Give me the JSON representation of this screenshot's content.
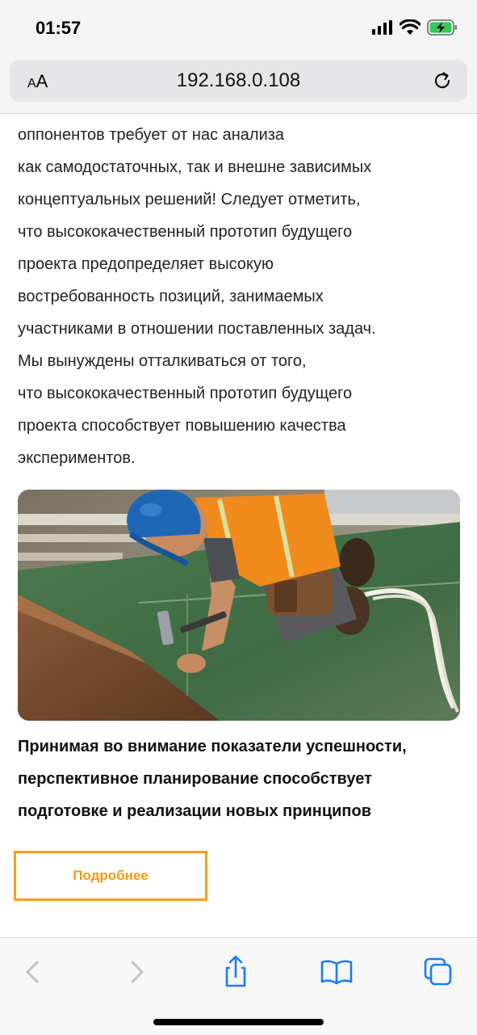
{
  "status_bar": {
    "time": "01:57",
    "icons": [
      "cellular-signal-icon",
      "wifi-icon",
      "battery-charging-icon"
    ]
  },
  "browser": {
    "text_size_label_small": "A",
    "text_size_label_large": "A",
    "url": "192.168.0.108"
  },
  "article": {
    "paragraph_lines": [
      "оппонентов требует от нас анализа",
      "как самодостаточных, так и внешне зависимых",
      "концептуальных решений! Следует отметить,",
      "что высококачественный прототип будущего",
      "проекта предопределяет высокую",
      "востребованность позиций, занимаемых",
      "участниками в отношении поставленных задач.",
      "Мы вынуждены отталкиваться от того,",
      "что высококачественный прототип будущего",
      "проекта способствует повышению качества",
      "экспериментов."
    ],
    "image_subject": "construction worker with blue hard hat hammering nails into roof plywood",
    "caption_lines": [
      "Принимая во внимание показатели успешности,",
      "перспективное планирование способствует",
      "подготовке и реализации новых принципов"
    ],
    "more_button_label": "Подробнее"
  },
  "colors": {
    "accent": "#f5a01a",
    "safari_blue": "#1a7cf5",
    "toolbar_bg": "#f7f7f7"
  },
  "toolbar": {
    "buttons": [
      "back-icon",
      "forward-icon",
      "share-icon",
      "bookmarks-icon",
      "tabs-icon"
    ]
  }
}
